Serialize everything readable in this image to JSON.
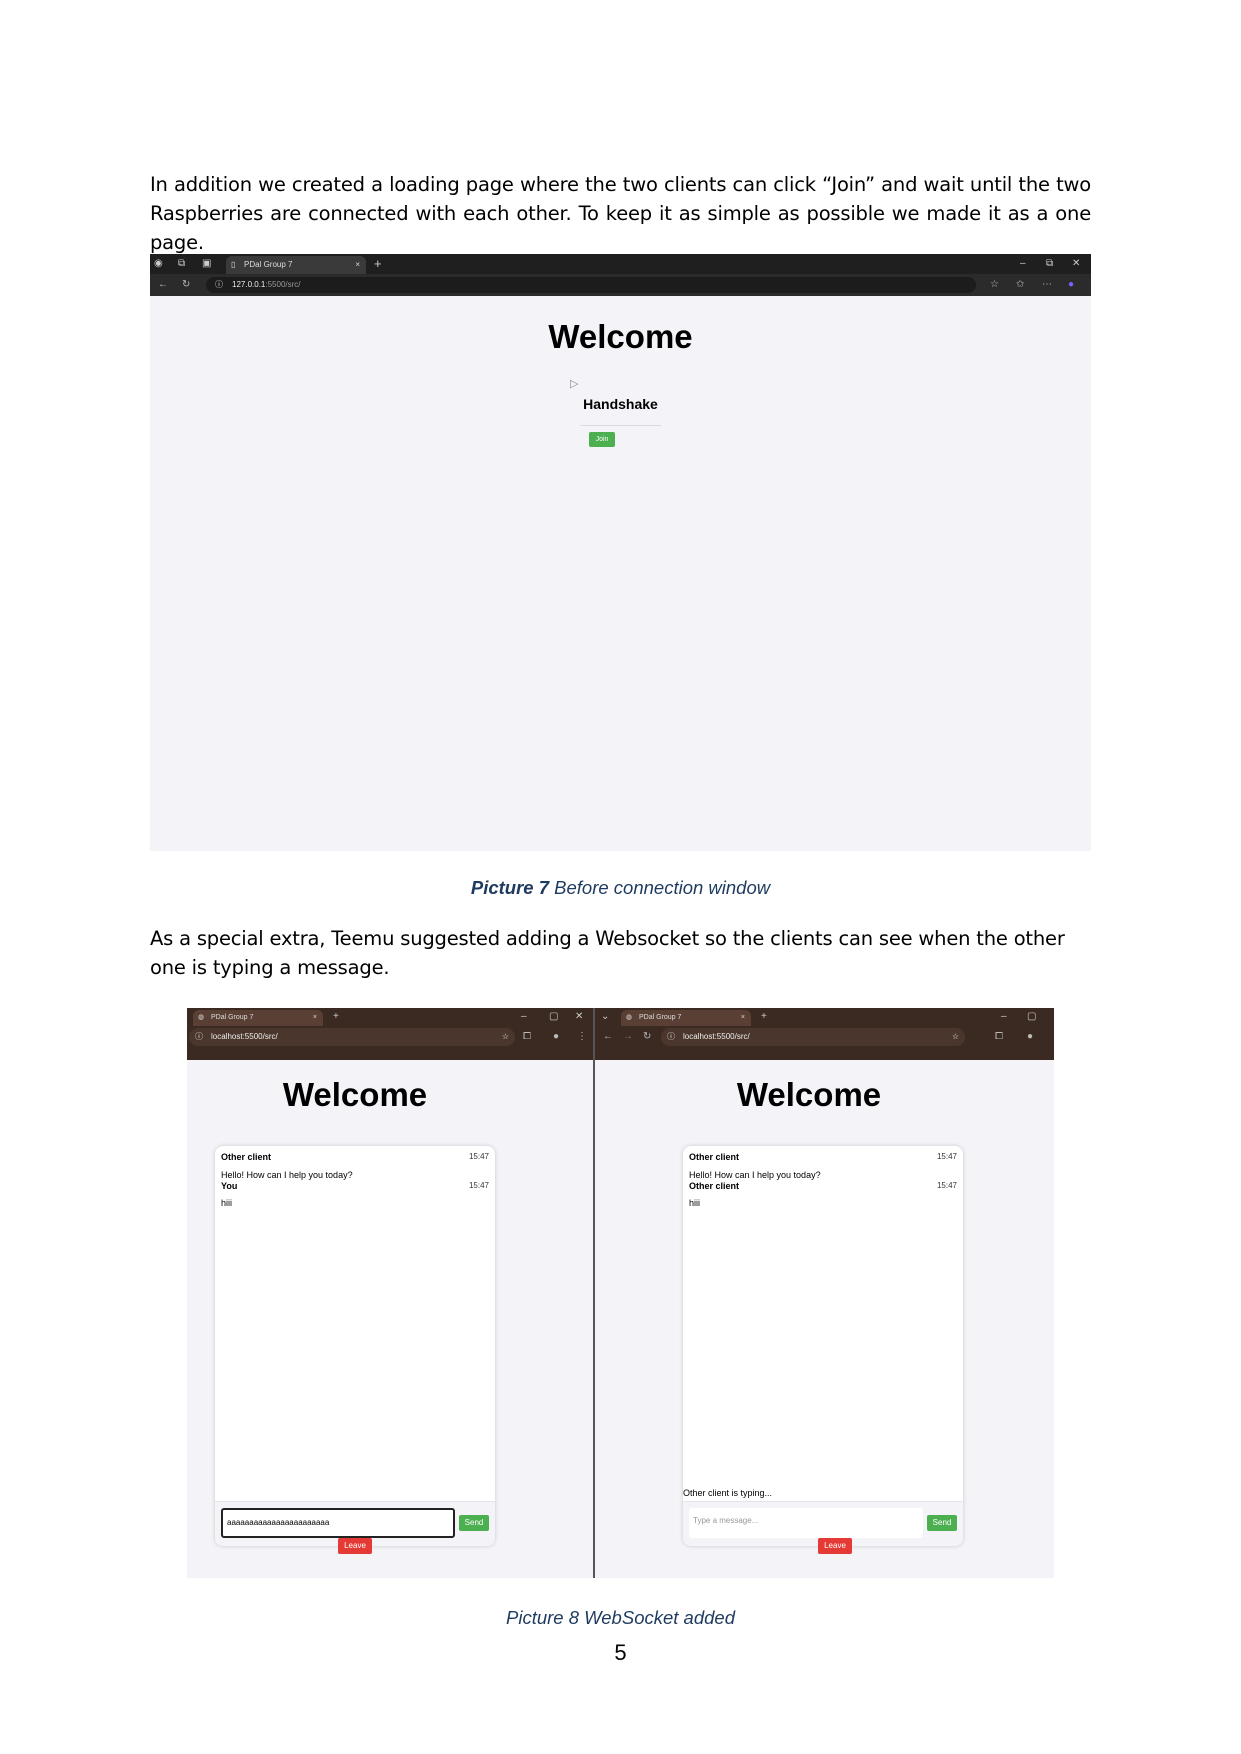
{
  "doc": {
    "para1": "In addition we created a loading page where the two clients can click “Join” and  wait until the two Raspberries are connected with each other. To keep it as simple as possible we made it as a one page.",
    "para2": "As a special extra, Teemu suggested adding  a Websocket so the clients can see when the other one is typing a message.",
    "caption1_label": "Picture 7",
    "caption1_text": " Before connection window",
    "caption2": "Picture 8 WebSocket added",
    "page_number": "5"
  },
  "shot1": {
    "tab_title": "PDal Group 7",
    "url_host": "127.0.0.1",
    "url_rest": ":5500/src/",
    "heading": "Welcome",
    "handshake": "Handshake",
    "join_label": "Join"
  },
  "shot2": {
    "tab_title": "PDal Group 7",
    "url": "localhost:5500/src/",
    "heading": "Welcome",
    "left": {
      "messages": [
        {
          "name": "Other client",
          "time": "15:47",
          "text": "Hello! How can I help you today?"
        },
        {
          "name": "You",
          "time": "15:47",
          "text": "hiii"
        }
      ],
      "input_value": "aaaaaaaaaaaaaaaaaaaaaaa",
      "send_label": "Send",
      "leave_label": "Leave"
    },
    "right": {
      "messages": [
        {
          "name": "Other client",
          "time": "15:47",
          "text": "Hello! How can I help you today?"
        },
        {
          "name": "Other client",
          "time": "15:47",
          "text": "hiii"
        }
      ],
      "typing_status": "Other client is typing...",
      "input_placeholder": "Type a message...",
      "send_label": "Send",
      "leave_label": "Leave"
    }
  },
  "colors": {
    "green": "#4caf50",
    "red": "#e53935",
    "caption": "#1f3a5f"
  },
  "icons": [
    "profile-icon",
    "tabs-icon",
    "window-icon",
    "page-icon",
    "close-icon",
    "new-tab-icon",
    "minimize-icon",
    "restore-icon",
    "back-icon",
    "reload-icon",
    "info-icon",
    "star-icon",
    "favorites-icon",
    "more-icon",
    "copilot-icon",
    "cursor-icon",
    "extensions-icon",
    "menu-icon",
    "forward-icon"
  ]
}
